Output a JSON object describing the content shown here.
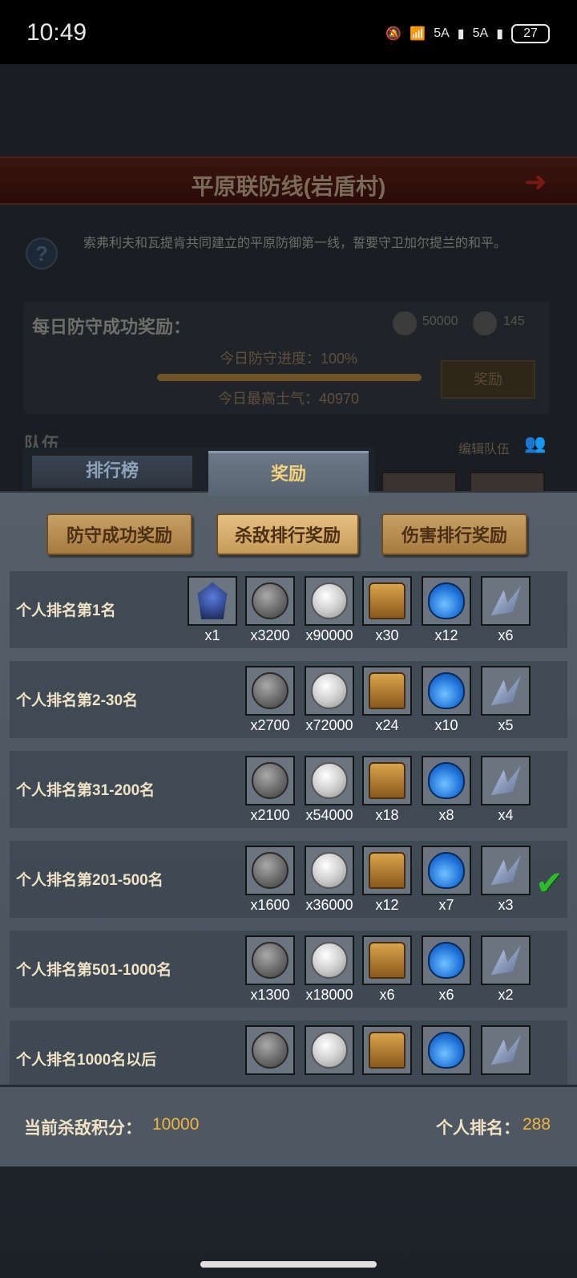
{
  "status_bar": {
    "time": "10:49",
    "network_1": "5A",
    "network_2": "5A",
    "battery": "27"
  },
  "header": {
    "title": "平原联防线(岩盾村)",
    "description": "索弗利夫和瓦提肯共同建立的平原防御第一线，誓要守卫加尔提兰的和平。"
  },
  "daily": {
    "title": "每日防守成功奖励：",
    "reward_1": "50000",
    "reward_2": "145",
    "progress_label": "今日防守进度：100%",
    "progress_percent": 100,
    "morale_label": "今日最高士气：40970",
    "claim_label": "奖励"
  },
  "team": {
    "label": "队伍",
    "edit_label": "编辑队伍"
  },
  "tabs": [
    {
      "label": "排行榜",
      "active": false
    },
    {
      "label": "奖励",
      "active": true
    }
  ],
  "sub_tabs": [
    {
      "label": "防守成功奖励",
      "active": false
    },
    {
      "label": "杀敌排行奖励",
      "active": true
    },
    {
      "label": "伤害排行奖励",
      "active": false
    }
  ],
  "reward_rows": [
    {
      "label": "个人排名第1名",
      "achieved": false,
      "items": [
        {
          "icon": "hero-card-icon",
          "qty": "x1"
        },
        {
          "icon": "dark-coin-icon",
          "qty": "x3200"
        },
        {
          "icon": "silver-coin-icon",
          "qty": "x90000"
        },
        {
          "icon": "treasure-chest-icon",
          "qty": "x30"
        },
        {
          "icon": "potion-icon",
          "qty": "x12"
        },
        {
          "icon": "crystal-icon",
          "qty": "x6"
        }
      ]
    },
    {
      "label": "个人排名第2-30名",
      "achieved": false,
      "items": [
        {
          "icon": "dark-coin-icon",
          "qty": "x2700"
        },
        {
          "icon": "silver-coin-icon",
          "qty": "x72000"
        },
        {
          "icon": "treasure-chest-icon",
          "qty": "x24"
        },
        {
          "icon": "potion-icon",
          "qty": "x10"
        },
        {
          "icon": "crystal-icon",
          "qty": "x5"
        }
      ]
    },
    {
      "label": "个人排名第31-200名",
      "achieved": false,
      "items": [
        {
          "icon": "dark-coin-icon",
          "qty": "x2100"
        },
        {
          "icon": "silver-coin-icon",
          "qty": "x54000"
        },
        {
          "icon": "treasure-chest-icon",
          "qty": "x18"
        },
        {
          "icon": "potion-icon",
          "qty": "x8"
        },
        {
          "icon": "crystal-icon",
          "qty": "x4"
        }
      ]
    },
    {
      "label": "个人排名第201-500名",
      "achieved": true,
      "items": [
        {
          "icon": "dark-coin-icon",
          "qty": "x1600"
        },
        {
          "icon": "silver-coin-icon",
          "qty": "x36000"
        },
        {
          "icon": "treasure-chest-icon",
          "qty": "x12"
        },
        {
          "icon": "potion-icon",
          "qty": "x7"
        },
        {
          "icon": "crystal-icon",
          "qty": "x3"
        }
      ]
    },
    {
      "label": "个人排名第501-1000名",
      "achieved": false,
      "items": [
        {
          "icon": "dark-coin-icon",
          "qty": "x1300"
        },
        {
          "icon": "silver-coin-icon",
          "qty": "x18000"
        },
        {
          "icon": "treasure-chest-icon",
          "qty": "x6"
        },
        {
          "icon": "potion-icon",
          "qty": "x6"
        },
        {
          "icon": "crystal-icon",
          "qty": "x2"
        }
      ]
    },
    {
      "label": "个人排名1000名以后",
      "achieved": false,
      "items": [
        {
          "icon": "dark-coin-icon",
          "qty": ""
        },
        {
          "icon": "silver-coin-icon",
          "qty": ""
        },
        {
          "icon": "treasure-chest-icon",
          "qty": ""
        },
        {
          "icon": "potion-icon",
          "qty": ""
        },
        {
          "icon": "crystal-icon",
          "qty": ""
        }
      ]
    }
  ],
  "footer": {
    "score_label": "当前杀敌积分：",
    "score_value": "10000",
    "rank_label": "个人排名：",
    "rank_value": "288"
  }
}
